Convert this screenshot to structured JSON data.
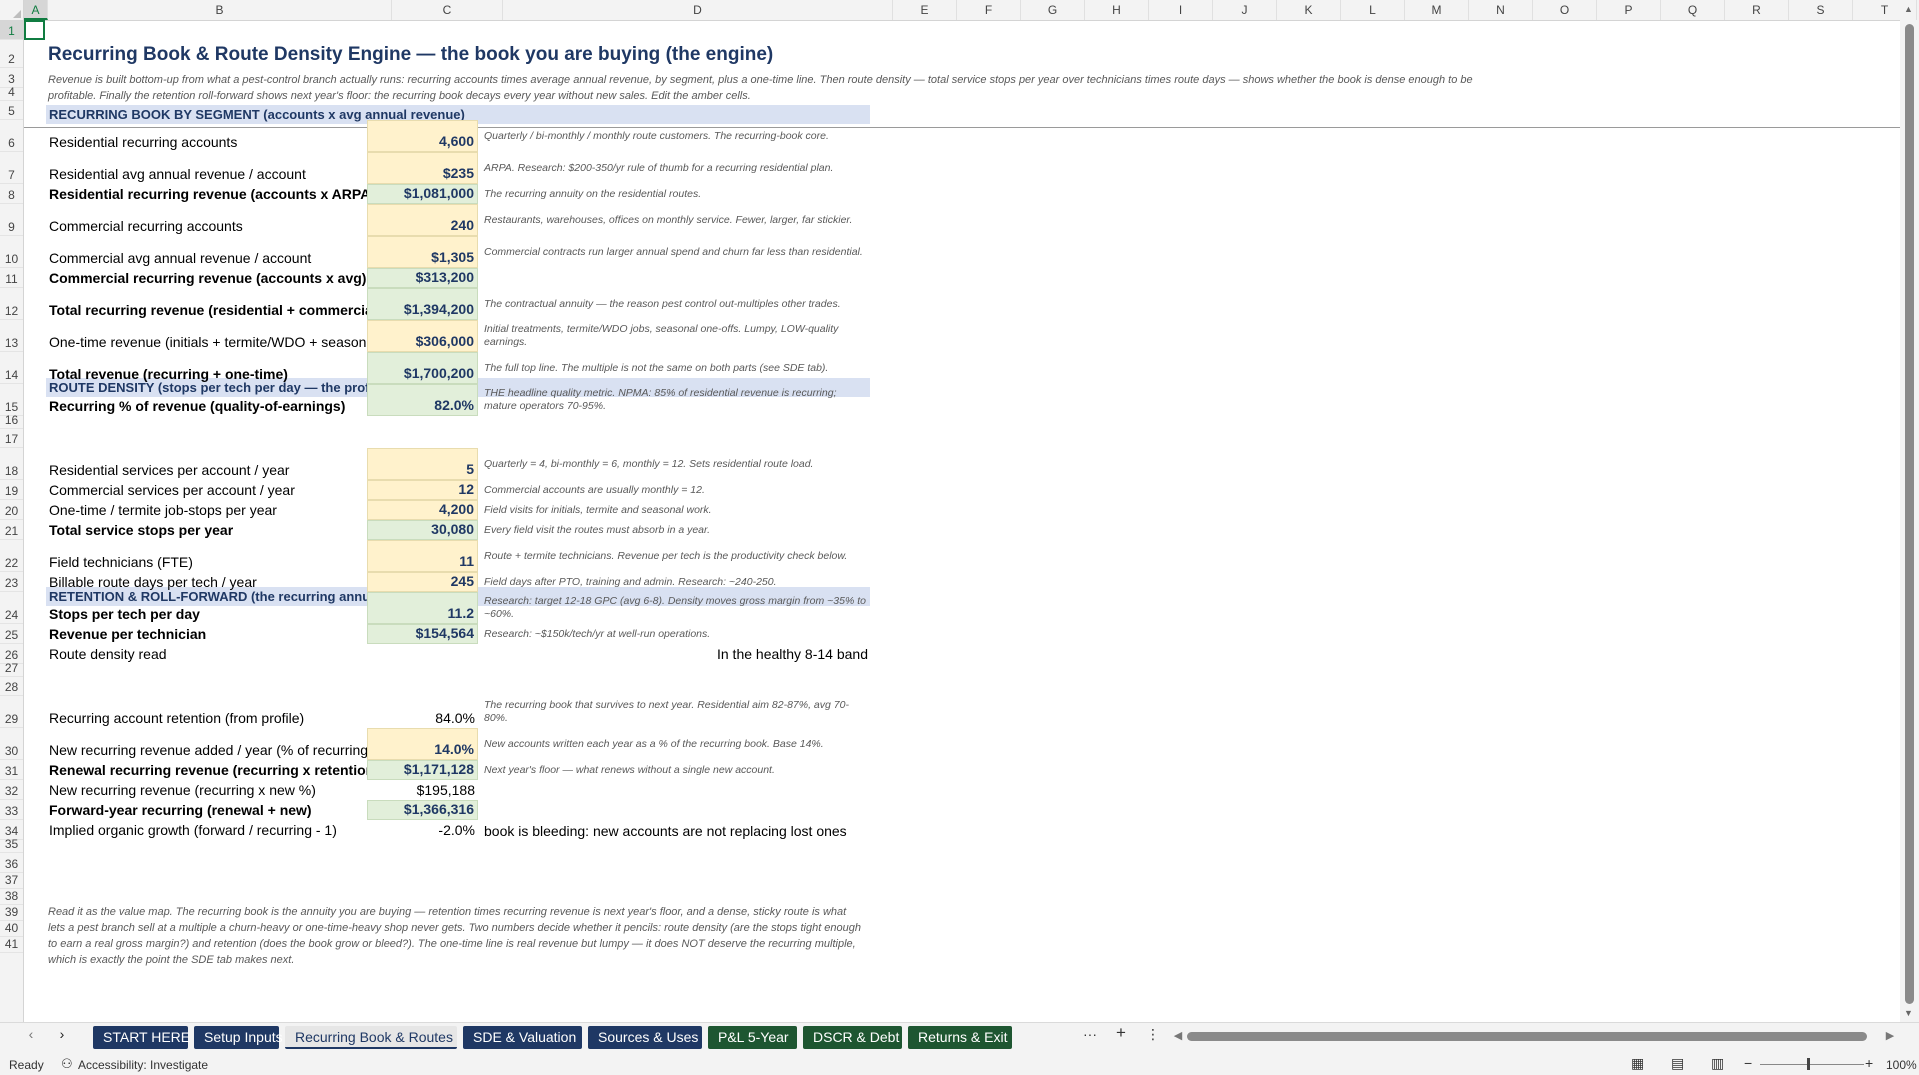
{
  "columns": [
    "A",
    "B",
    "C",
    "D",
    "E",
    "F",
    "G",
    "H",
    "I",
    "J",
    "K",
    "L",
    "M",
    "N",
    "O",
    "P",
    "Q",
    "R",
    "S",
    "T"
  ],
  "rows": [
    "1",
    "2",
    "3",
    "4",
    "5",
    "6",
    "7",
    "8",
    "9",
    "10",
    "11",
    "12",
    "13",
    "14",
    "15",
    "16",
    "17",
    "18",
    "19",
    "20",
    "21",
    "22",
    "23",
    "24",
    "25",
    "26",
    "27",
    "28",
    "29",
    "30",
    "31",
    "32",
    "33",
    "34",
    "35",
    "36",
    "37",
    "38",
    "39",
    "40",
    "41"
  ],
  "title": "Recurring Book & Route Density Engine — the book you are buying (the engine)",
  "subtitle": "Revenue is built bottom-up from what a pest-control branch actually runs: recurring accounts times average annual revenue, by segment, plus a one-time line. Then route density — total service stops per year over technicians times route days — shows whether the book is dense enough to be profitable. Finally the retention roll-forward shows next year's floor: the recurring book decays every year without new sales. Edit the amber cells.",
  "sections": {
    "segment": "RECURRING BOOK BY SEGMENT  (accounts x avg annual revenue)",
    "density": "ROUTE DENSITY  (stops per tech per day — the profitability lever)",
    "retention": "RETENTION & ROLL-FORWARD  (the recurring annuity decays)"
  },
  "lines": [
    {
      "label": "Residential recurring accounts",
      "value": "4,600",
      "note": "Quarterly / bi-monthly / monthly route customers. The recurring-book core."
    },
    {
      "label": "Residential avg annual revenue / account",
      "value": "$235",
      "note": "ARPA. Research: $200-350/yr rule of thumb for a recurring residential plan."
    },
    {
      "label": "Residential recurring revenue (accounts x ARPA)",
      "value": "$1,081,000",
      "note": "The recurring annuity on the residential routes."
    },
    {
      "label": "Commercial recurring accounts",
      "value": "240",
      "note": "Restaurants, warehouses, offices on monthly service. Fewer, larger, far stickier."
    },
    {
      "label": "Commercial avg annual revenue / account",
      "value": "$1,305",
      "note": "Commercial contracts run larger annual spend and churn far less than residential."
    },
    {
      "label": "Commercial recurring revenue (accounts x avg)",
      "value": "$313,200",
      "note": ""
    },
    {
      "label": "Total recurring revenue (residential + commercial)",
      "value": "$1,394,200",
      "note": "The contractual annuity — the reason pest control out-multiples other trades."
    },
    {
      "label": "One-time revenue (initials + termite/WDO + seasonal)",
      "value": "$306,000",
      "note": "Initial treatments, termite/WDO jobs, seasonal one-offs. Lumpy, LOW-quality earnings."
    },
    {
      "label": "Total revenue (recurring + one-time)",
      "value": "$1,700,200",
      "note": "The full top line. The multiple is not the same on both parts (see SDE tab)."
    },
    {
      "label": "Recurring % of revenue (quality-of-earnings)",
      "value": "82.0%",
      "note": "THE headline quality metric. NPMA: 85% of residential revenue is recurring; mature operators 70-95%."
    },
    {
      "label": "Residential services per account / year",
      "value": "5",
      "note": "Quarterly = 4, bi-monthly = 6, monthly = 12. Sets residential route load."
    },
    {
      "label": "Commercial services per account / year",
      "value": "12",
      "note": "Commercial accounts are usually monthly = 12."
    },
    {
      "label": "One-time / termite job-stops per year",
      "value": "4,200",
      "note": "Field visits for initials, termite and seasonal work."
    },
    {
      "label": "Total service stops per year",
      "value": "30,080",
      "note": "Every field visit the routes must absorb in a year."
    },
    {
      "label": "Field technicians (FTE)",
      "value": "11",
      "note": "Route + termite technicians. Revenue per tech is the productivity check below."
    },
    {
      "label": "Billable route days per tech / year",
      "value": "245",
      "note": "Field days after PTO, training and admin. Research: ~240-250."
    },
    {
      "label": "Stops per tech per day",
      "value": "11.2",
      "note": "Research: target 12-18 GPC (avg 6-8). Density moves gross margin from ~35% to ~60%."
    },
    {
      "label": "Revenue per technician",
      "value": "$154,564",
      "note": "Research: ~$150k/tech/yr at well-run operations."
    },
    {
      "label": "Route density read",
      "value": "In the healthy 8-14 band",
      "note": ""
    },
    {
      "label": "Recurring account retention (from profile)",
      "value": "84.0%",
      "note": "The recurring book that survives to next year. Residential aim 82-87%, avg 70-80%."
    },
    {
      "label": "New recurring revenue added / year (% of recurring)",
      "value": "14.0%",
      "note": "New accounts written each year as a % of the recurring book. Base 14%."
    },
    {
      "label": "Renewal recurring revenue (recurring x retention)",
      "value": "$1,171,128",
      "note": "Next year's floor — what renews without a single new account."
    },
    {
      "label": "New recurring revenue (recurring x new %)",
      "value": "$195,188",
      "note": ""
    },
    {
      "label": "Forward-year recurring (renewal + new)",
      "value": "$1,366,316",
      "note": ""
    },
    {
      "label": "Implied organic growth (forward / recurring - 1)",
      "value": "-2.0%",
      "note": "book is bleeding: new accounts are not replacing lost ones"
    }
  ],
  "footnote": "Read it as the value map. The recurring book is the annuity you are buying — retention times recurring revenue is next year's floor, and a dense, sticky route is what lets a pest branch sell at a multiple a churn-heavy or one-time-heavy shop never gets. Two numbers decide whether it pencils: route density (are the stops tight enough to earn a real gross margin?) and retention (does the book grow or bleed?). The one-time line is real revenue but lumpy — it does NOT deserve the recurring multiple, which is exactly the point the SDE tab makes next.",
  "tabs": [
    {
      "label": "START HERE",
      "color": "#1f3864"
    },
    {
      "label": "Setup Inputs",
      "color": "#1f3864"
    },
    {
      "label": "Recurring Book & Routes",
      "color": "active"
    },
    {
      "label": "SDE & Valuation",
      "color": "#1f3864"
    },
    {
      "label": "Sources & Uses",
      "color": "#1f3864"
    },
    {
      "label": "P&L 5-Year",
      "color": "#1e5631"
    },
    {
      "label": "DSCR & Debt",
      "color": "#1e5631"
    },
    {
      "label": "Returns & Exit",
      "color": "#1e5631"
    }
  ],
  "tabbar": {
    "more": "···",
    "add": "+",
    "options": "⋮"
  },
  "status": {
    "ready": "Ready",
    "accessibility": "Accessibility: Investigate",
    "zoom": "100%"
  },
  "colors": {
    "input": "#fff2cc",
    "calc": "#e2efda",
    "section": "#d9e1f2",
    "navy": "#1f3864",
    "green": "#1e5631"
  }
}
